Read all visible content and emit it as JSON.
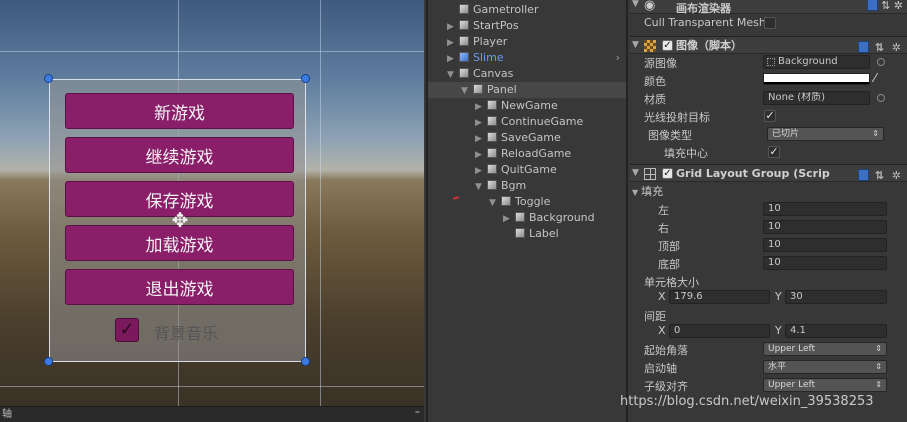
{
  "scene": {
    "buttons": [
      "新游戏",
      "继续游戏",
      "保存游戏",
      "加载游戏",
      "退出游戏"
    ],
    "toggle": {
      "label": "背景音乐",
      "checked": true,
      "check_glyph": "✓"
    },
    "cursor_glyph": "✥",
    "bottom_left": "轴",
    "bottom_right": "⁼"
  },
  "hierarchy": {
    "items": [
      {
        "label": "Gametroller",
        "indent": 0,
        "arrow": "",
        "prefab": false,
        "selected": false
      },
      {
        "label": "StartPos",
        "indent": 0,
        "arrow": "▶",
        "prefab": false,
        "selected": false
      },
      {
        "label": "Player",
        "indent": 0,
        "arrow": "▶",
        "prefab": false,
        "selected": false
      },
      {
        "label": "Slime",
        "indent": 0,
        "arrow": "▶",
        "prefab": true,
        "selected": false
      },
      {
        "label": "Canvas",
        "indent": 0,
        "arrow": "▼",
        "prefab": false,
        "selected": false
      },
      {
        "label": "Panel",
        "indent": 1,
        "arrow": "▼",
        "prefab": false,
        "selected": true
      },
      {
        "label": "NewGame",
        "indent": 2,
        "arrow": "▶",
        "prefab": false,
        "selected": false
      },
      {
        "label": "ContinueGame",
        "indent": 2,
        "arrow": "▶",
        "prefab": false,
        "selected": false
      },
      {
        "label": "SaveGame",
        "indent": 2,
        "arrow": "▶",
        "prefab": false,
        "selected": false
      },
      {
        "label": "ReloadGame",
        "indent": 2,
        "arrow": "▶",
        "prefab": false,
        "selected": false
      },
      {
        "label": "QuitGame",
        "indent": 2,
        "arrow": "▶",
        "prefab": false,
        "selected": false
      },
      {
        "label": "Bgm",
        "indent": 2,
        "arrow": "▼",
        "prefab": false,
        "selected": false
      },
      {
        "label": "Toggle",
        "indent": 3,
        "arrow": "▼",
        "prefab": false,
        "selected": false
      },
      {
        "label": "Background",
        "indent": 4,
        "arrow": "▶",
        "prefab": false,
        "selected": false
      },
      {
        "label": "Label",
        "indent": 4,
        "arrow": "",
        "prefab": false,
        "selected": false
      }
    ],
    "expand_arrow": "›"
  },
  "inspector": {
    "canvas_renderer": {
      "title": "画布渲染器",
      "cull_label": "Cull Transparent Mesh",
      "cull_checked": false
    },
    "image": {
      "title": "图像（脚本）",
      "source_label": "源图像",
      "source_value": "Background",
      "color_label": "颜色",
      "color_value": "#ffffff",
      "material_label": "材质",
      "material_value": "None (材质)",
      "raycast_label": "光线投射目标",
      "raycast_checked": true,
      "type_label": "图像类型",
      "type_value": "已切片",
      "fill_center_label": "填充中心",
      "fill_center_checked": true
    },
    "grid": {
      "title": "Grid Layout Group (Scrip",
      "padding_label": "填充",
      "left_label": "左",
      "left_value": "10",
      "right_label": "右",
      "right_value": "10",
      "top_label": "顶部",
      "top_value": "10",
      "bottom_label": "底部",
      "bottom_value": "10",
      "cell_size_label": "单元格大小",
      "cell_x_label": "X",
      "cell_x": "179.6",
      "cell_y_label": "Y",
      "cell_y": "30",
      "spacing_label": "间距",
      "spacing_x_label": "X",
      "spacing_x": "0",
      "spacing_y_label": "Y",
      "spacing_y": "4.1",
      "start_corner_label": "起始角落",
      "start_corner_value": "Upper Left",
      "start_axis_label": "启动轴",
      "start_axis_value": "水平",
      "child_align_label": "子级对齐",
      "child_align_value": "Upper Left"
    },
    "icons": {
      "book": "",
      "settings": "⇅ ✲"
    },
    "dropdown_arrow": "⇕",
    "check_glyph": "✓",
    "eye_glyph": "◉",
    "fold_open": "▼"
  },
  "watermark": "https://blog.csdn.net/weixin_39538253"
}
